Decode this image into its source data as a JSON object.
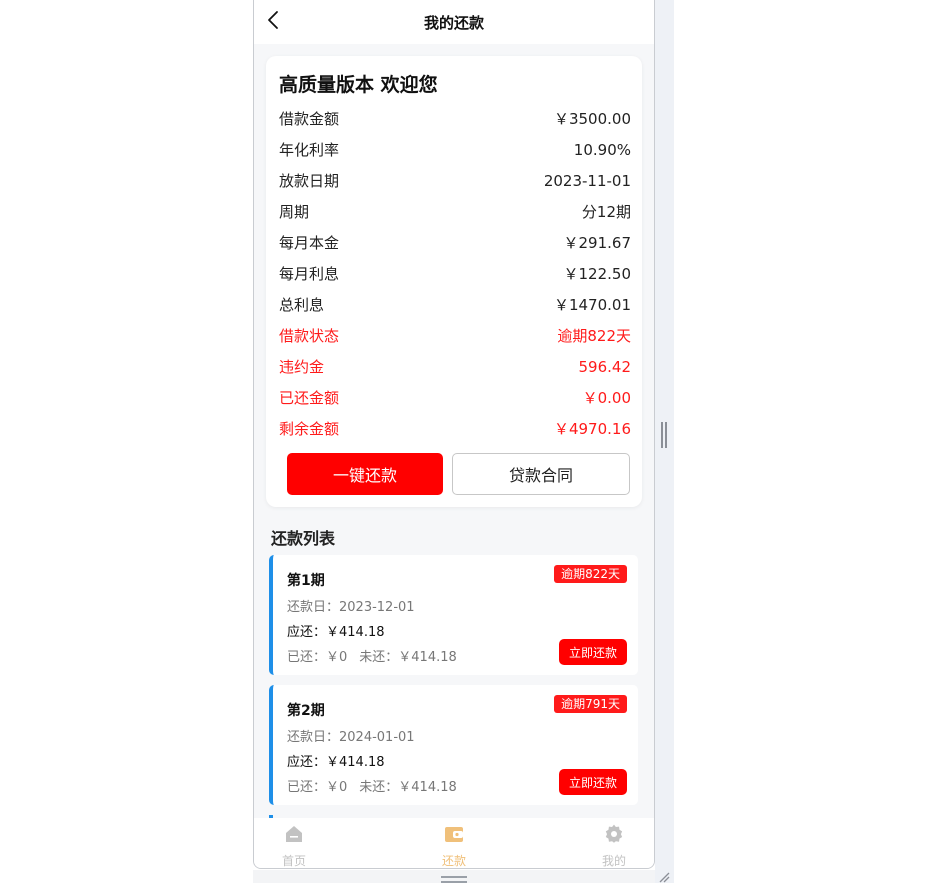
{
  "header": {
    "title": "我的还款"
  },
  "summary": {
    "title": "高质量版本 欢迎您",
    "rows": [
      {
        "label": "借款金额",
        "value": "￥3500.00",
        "highlight": false
      },
      {
        "label": "年化利率",
        "value": "10.90%",
        "highlight": false
      },
      {
        "label": "放款日期",
        "value": "2023-11-01",
        "highlight": false
      },
      {
        "label": "周期",
        "value": "分12期",
        "highlight": false
      },
      {
        "label": "每月本金",
        "value": "￥291.67",
        "highlight": false
      },
      {
        "label": "每月利息",
        "value": "￥122.50",
        "highlight": false
      },
      {
        "label": "总利息",
        "value": "￥1470.01",
        "highlight": false
      },
      {
        "label": "借款状态",
        "value": "逾期822天",
        "highlight": true
      },
      {
        "label": "违约金",
        "value": "596.42",
        "highlight": true
      },
      {
        "label": "已还金额",
        "value": "￥0.00",
        "highlight": true
      },
      {
        "label": "剩余金额",
        "value": "￥4970.16",
        "highlight": true
      }
    ],
    "pay_all_label": "一键还款",
    "contract_label": "贷款合同"
  },
  "repay_list": {
    "title": "还款列表",
    "items": [
      {
        "period": "第1期",
        "badge": "逾期822天",
        "date": "还款日：2023-12-01",
        "due": "应还：￥414.18",
        "paid": "已还：￥0",
        "unpaid": "未还：￥414.18",
        "pay_label": "立即还款"
      },
      {
        "period": "第2期",
        "badge": "逾期791天",
        "date": "还款日：2024-01-01",
        "due": "应还：￥414.18",
        "paid": "已还：￥0",
        "unpaid": "未还：￥414.18",
        "pay_label": "立即还款"
      }
    ]
  },
  "tabbar": {
    "items": [
      {
        "label": "首页",
        "icon": "home-icon",
        "active": false
      },
      {
        "label": "还款",
        "icon": "wallet-icon",
        "active": true
      },
      {
        "label": "我的",
        "icon": "gear-icon",
        "active": false
      }
    ]
  },
  "colors": {
    "accent_red": "#ff0000",
    "card_border_blue": "#1e8fe8",
    "tab_active": "#f0c07a",
    "tab_inactive": "#c2c2c2"
  }
}
